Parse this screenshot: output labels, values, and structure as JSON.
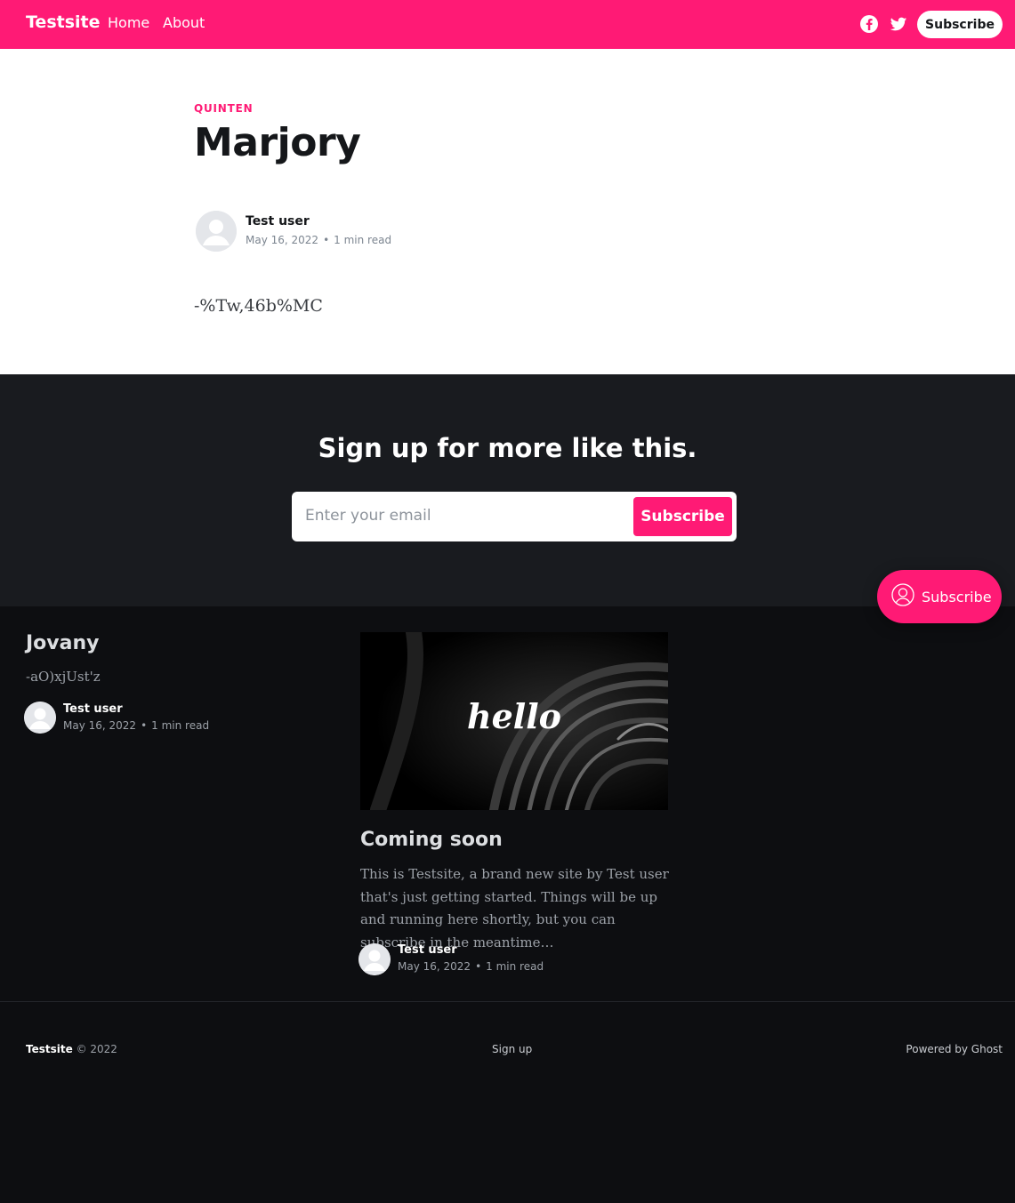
{
  "header": {
    "site_title": "Testsite",
    "nav": [
      {
        "label": "Home"
      },
      {
        "label": "About"
      }
    ],
    "subscribe_label": "Subscribe",
    "accent_color": "#ff1a75",
    "social_icons": [
      "facebook-icon",
      "twitter-icon"
    ]
  },
  "article": {
    "tag": "QUINTEN",
    "title": "Marjory",
    "author": "Test user",
    "date": "May 16, 2022",
    "separator": "•",
    "read_time": "1 min read",
    "body": "-%Tw,46b%MC"
  },
  "signup": {
    "title": "Sign up for more like this.",
    "email_placeholder": "Enter your email",
    "button_label": "Subscribe"
  },
  "portal_button": {
    "label": "Subscribe",
    "icon": "user-circle-icon"
  },
  "feed": {
    "cards": [
      {
        "title": "Jovany",
        "excerpt": "-aO)xjUst'z",
        "author": "Test user",
        "date": "May 16, 2022",
        "read_time": "1 min read"
      },
      {
        "title": "Coming soon",
        "image_text": "hello",
        "excerpt": "This is Testsite, a brand new site by Test user that's just getting started. Things will be up and running here shortly, but you can subscribe in the meantime…",
        "author": "Test user",
        "date": "May 16, 2022",
        "read_time": "1 min read"
      }
    ]
  },
  "footer": {
    "site_title": "Testsite",
    "copyright": "© 2022",
    "signup_link": "Sign up",
    "powered_by": "Powered by Ghost"
  }
}
